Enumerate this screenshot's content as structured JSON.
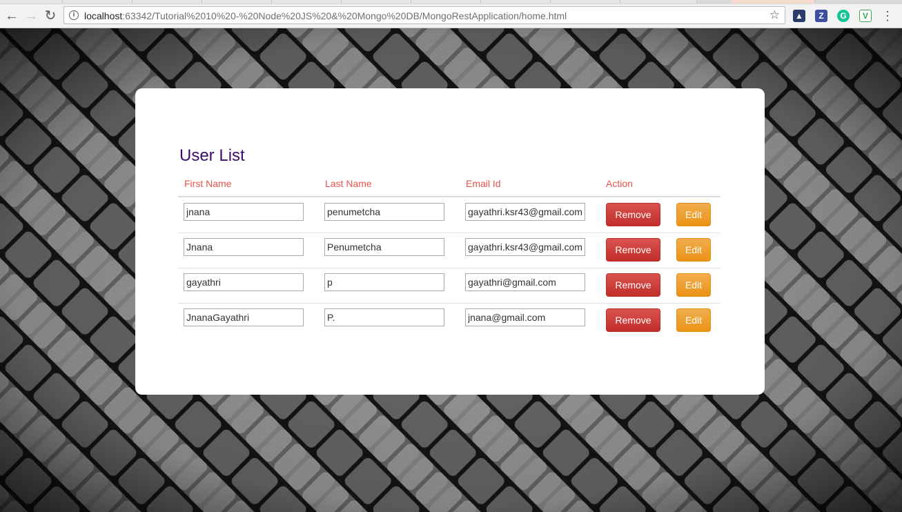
{
  "browser": {
    "url_host": "localhost",
    "url_rest": ":63342/Tutorial%2010%20-%20Node%20JS%20&%20Mongo%20DB/MongoRestApplication/home.html"
  },
  "page": {
    "title": "User List",
    "columns": [
      "First Name",
      "Last Name",
      "Email Id",
      "Action"
    ],
    "remove_label": "Remove",
    "edit_label": "Edit",
    "users": [
      {
        "first": "jnana",
        "last": "penumetcha",
        "email": "gayathri.ksr43@gmail.com"
      },
      {
        "first": "Jnana",
        "last": "Penumetcha",
        "email": "gayathri.ksr43@gmail.com"
      },
      {
        "first": "gayathri",
        "last": "p",
        "email": "gayathri@gmail.com"
      },
      {
        "first": "JnanaGayathri",
        "last": "P.",
        "email": "jnana@gmail.com"
      }
    ]
  },
  "colors": {
    "title": "#3d0c6e",
    "header": "#e8534b",
    "remove": "#d9534f",
    "edit": "#f0ad4e"
  }
}
